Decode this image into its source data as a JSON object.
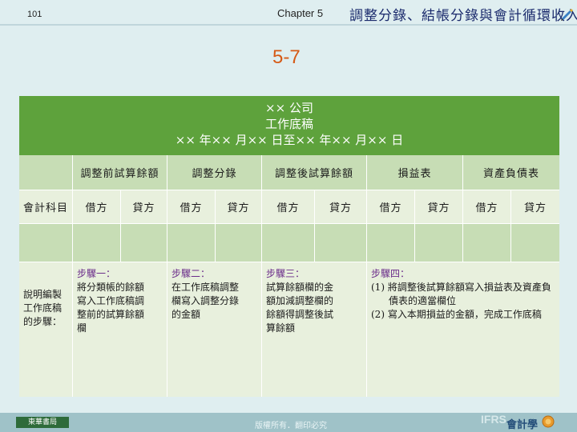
{
  "header": {
    "page_number": "101",
    "chapter": "Chapter  5",
    "chapter_title": "調整分錄、結帳分錄與會計循環收入"
  },
  "slide_label": "5-7",
  "worksheet": {
    "banner": {
      "line1": "×× 公司",
      "line2": "工作底稿",
      "line3": "×× 年×× 月×× 日至×× 年×× 月×× 日"
    },
    "groups": [
      "調整前試算餘額",
      "調整分錄",
      "調整後試算餘額",
      "損益表",
      "資產負債表"
    ],
    "account_label": "會計科目",
    "debit": "借方",
    "credit": "貸方",
    "notes": {
      "label": [
        "說明編製",
        "工作底稿",
        "的步驟："
      ],
      "step1": {
        "title": "步驟一：",
        "lines": [
          "將分類帳的餘額",
          "寫入工作底稿調",
          "整前的試算餘額",
          "欄"
        ]
      },
      "step2": {
        "title": "步驟二：",
        "lines": [
          "在工作底稿調整",
          "欄寫入調整分錄",
          "的金額"
        ]
      },
      "step3": {
        "title": "步驟三：",
        "lines": [
          "試算餘額欄的金",
          "額加減調整欄的",
          "餘額得調整後試",
          "算餘額"
        ]
      },
      "step4": {
        "title": "步驟四：",
        "items": [
          "(1) 將調整後試算餘額寫入損益表及資產負債表的適當欄位",
          "(2) 寫入本期損益的金額，完成工作底稿"
        ]
      }
    }
  },
  "footer": {
    "publisher": "東華書局",
    "copyright": "版權所有．翻印必究",
    "brand_mark": "IFRS",
    "book_title": "會計學"
  },
  "colors": {
    "banner_green": "#5ea23c",
    "cell_dark": "#c7ddb5",
    "cell_light": "#e8f0dd",
    "step_title": "#6b2d8a",
    "slide_label": "#d65a16",
    "background": "#dfeef0"
  }
}
